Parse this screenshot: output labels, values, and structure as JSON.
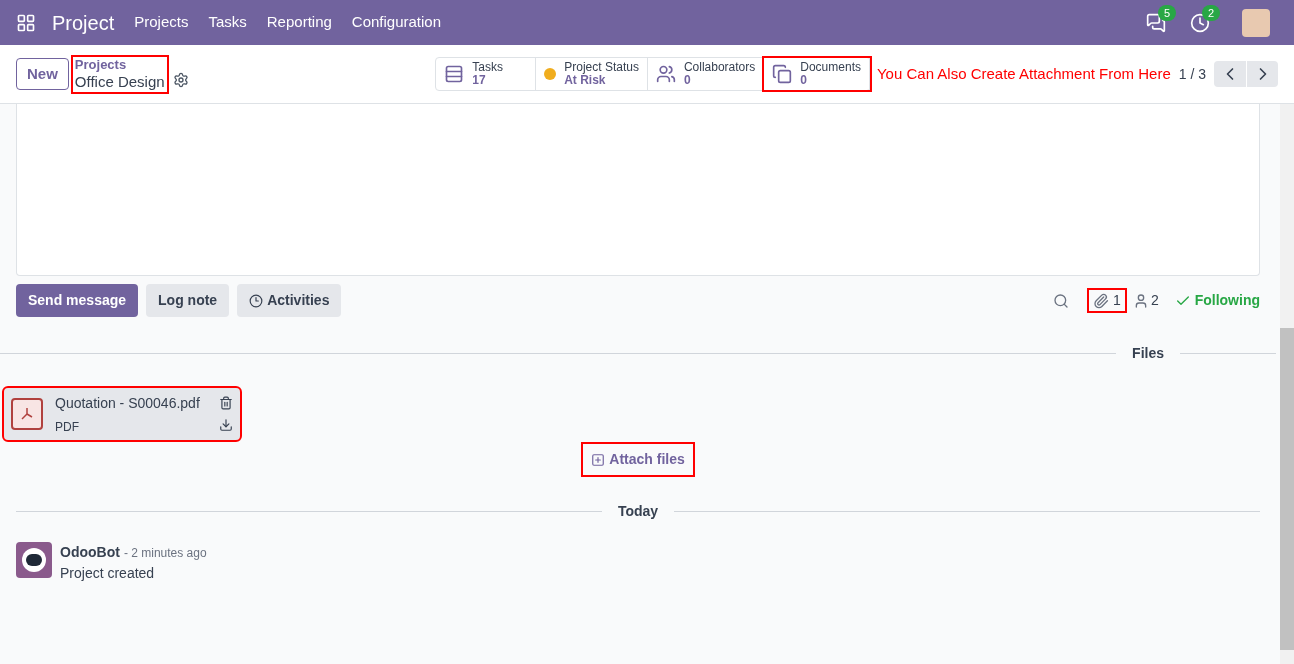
{
  "navbar": {
    "app": "Project",
    "menu": [
      "Projects",
      "Tasks",
      "Reporting",
      "Configuration"
    ],
    "messages_count": "5",
    "activities_count": "2"
  },
  "control_panel": {
    "new_button": "New",
    "breadcrumb": {
      "parent": "Projects",
      "current": "Office Design",
      "annotated": true
    },
    "stat_buttons": [
      {
        "kind": "tasks",
        "label": "Tasks",
        "value": "17",
        "annotated": false
      },
      {
        "kind": "status",
        "label": "Project Status",
        "value": "At Risk",
        "color": "#f0ad1e",
        "annotated": false
      },
      {
        "kind": "collaborators",
        "label": "Collaborators",
        "value": "0",
        "annotated": false
      },
      {
        "kind": "documents",
        "label": "Documents",
        "value": "0",
        "annotated": true
      }
    ],
    "annotation": "You Can Also Create Attachment From Here",
    "pager": "1 / 3"
  },
  "chatter": {
    "buttons": [
      {
        "label": "Send message",
        "selected": true
      },
      {
        "label": "Log note",
        "selected": false
      },
      {
        "label": "Activities",
        "selected": false
      }
    ],
    "attachments_count": {
      "value": "1",
      "annotated": true
    },
    "followers_count": "2",
    "follow": "Following",
    "files_heading": "Files",
    "attachment": {
      "name": "Quotation - S00046.pdf",
      "type": "PDF",
      "annotated": true
    },
    "attach_button": {
      "label": "Attach files",
      "annotated": true
    },
    "date_heading": "Today",
    "message": {
      "author": "OdooBot",
      "time": "- 2 minutes ago",
      "body": "Project created"
    }
  }
}
